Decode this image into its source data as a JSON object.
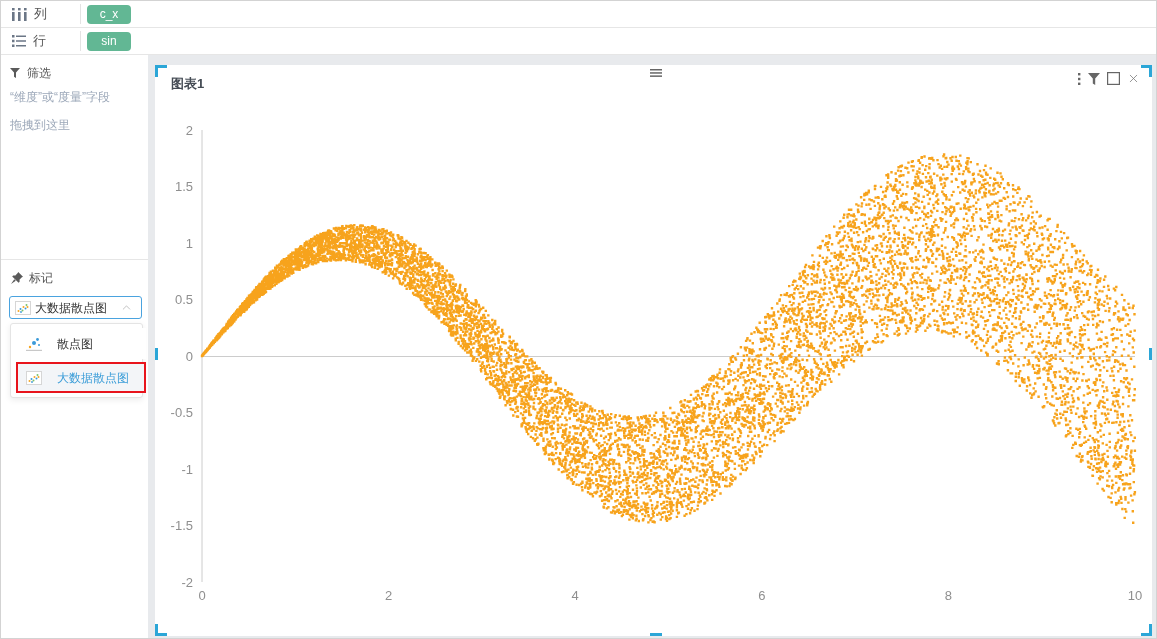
{
  "shelves": [
    {
      "kind": "columns",
      "label": "列",
      "fields": [
        "c_x"
      ]
    },
    {
      "kind": "rows",
      "label": "行",
      "fields": [
        "sin"
      ]
    }
  ],
  "filter_panel": {
    "title": "筛选",
    "hint": "“维度”或“度量”字段拖拽到这里"
  },
  "marks_panel": {
    "title": "标记",
    "select": {
      "kind": "big-scatter",
      "value": "大数据散点图",
      "expanded": true
    },
    "options": [
      {
        "kind": "scatter",
        "label": "散点图",
        "selected": false,
        "highlighted": false
      },
      {
        "kind": "big-scatter",
        "label": "大数据散点图",
        "selected": true,
        "highlighted": true
      }
    ]
  },
  "chart_card": {
    "title": "图表1",
    "selected": true,
    "chart_data": {
      "type": "scatter",
      "xlim": [
        0,
        10
      ],
      "ylim": [
        -2,
        2
      ],
      "xticks": [
        0,
        2,
        4,
        6,
        8,
        10
      ],
      "yticks": [
        2,
        1.5,
        1,
        0.5,
        0,
        -0.5,
        -1,
        -1.5,
        -2
      ]
    }
  }
}
